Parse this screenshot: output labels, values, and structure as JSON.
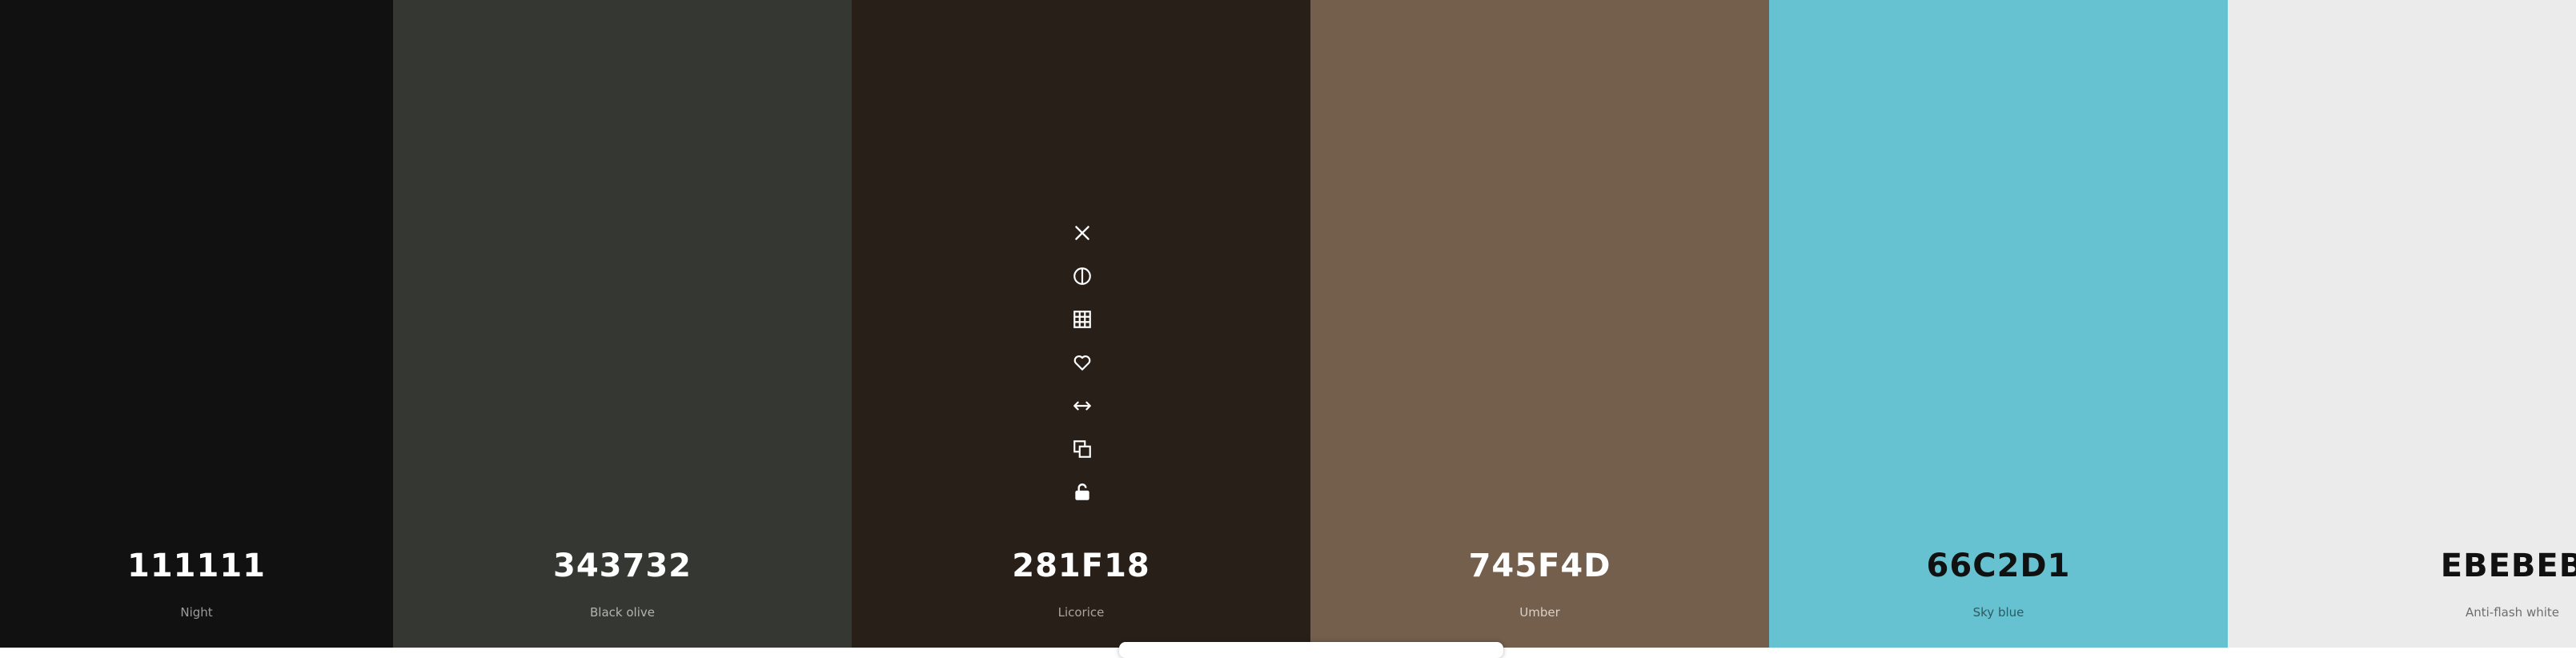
{
  "swatches": [
    {
      "hex_label": "111111",
      "name": "Night",
      "color": "#111111",
      "text_color": "#ffffff",
      "name_color": "#9a9a9a"
    },
    {
      "hex_label": "343732",
      "name": "Black olive",
      "color": "#343732",
      "text_color": "#ffffff",
      "name_color": "#b3b4b1"
    },
    {
      "hex_label": "281F18",
      "name": "Licorice",
      "color": "#281F18",
      "text_color": "#ffffff",
      "name_color": "#a9a4a0"
    },
    {
      "hex_label": "745F4D",
      "name": "Umber",
      "color": "#745F4D",
      "text_color": "#ffffff",
      "name_color": "#d9d0c8"
    },
    {
      "hex_label": "66C2D1",
      "name": "Sky blue",
      "color": "#66C2D1",
      "text_color": "#111111",
      "name_color": "#2c5a62"
    },
    {
      "hex_label": "EBEBEB",
      "name": "Anti-flash white",
      "color": "#EBEBEB",
      "text_color": "#111111",
      "name_color": "#6e6e6e"
    }
  ],
  "tools": [
    "close-icon",
    "contrast-icon",
    "grid-icon",
    "heart-icon",
    "drag-icon",
    "copy-icon",
    "lock-open-icon"
  ]
}
